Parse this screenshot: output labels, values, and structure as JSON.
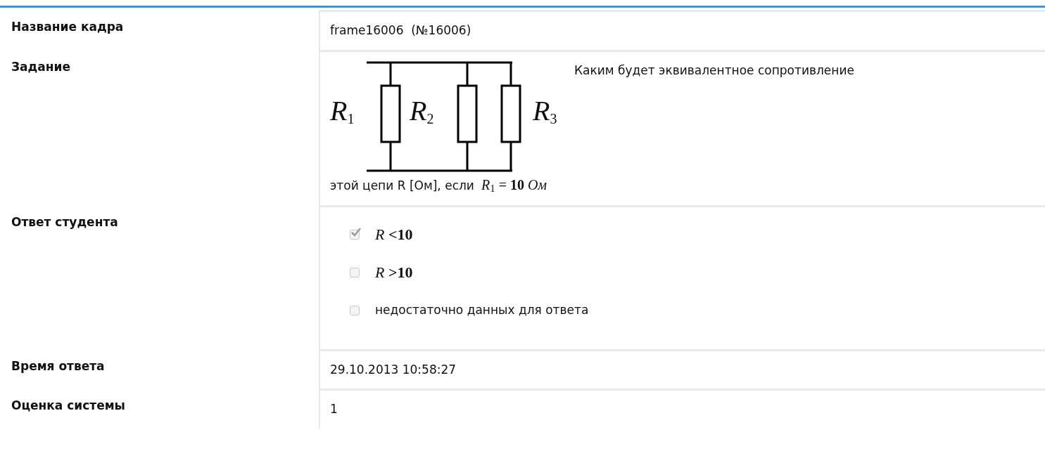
{
  "rows": [
    {
      "kind": "text",
      "label": "Название кадра",
      "value": "frame16006  (№16006)"
    },
    {
      "kind": "task",
      "label": "Задание",
      "circuit_labels": [
        "R",
        "R",
        "R"
      ],
      "circuit_indices": [
        "1",
        "2",
        "3"
      ],
      "question_lines": [
        "Каким будет эквивалентное сопротивление",
        "этой цепи R [Ом], если"
      ],
      "formula": "*R*$_{1}$ = **10** *Ом*"
    },
    {
      "kind": "answers",
      "label": "Ответ студента",
      "options": [
        {
          "text": "*R* **<10**",
          "checked": true
        },
        {
          "text": "*R* **>10**",
          "checked": false
        },
        {
          "text": "недостаточно данных для ответа",
          "checked": false
        }
      ]
    },
    {
      "kind": "text",
      "label": "Время ответа",
      "value": "29.10.2013 10:58:27"
    },
    {
      "kind": "text",
      "label": "Оценка системы",
      "value": "1"
    }
  ]
}
